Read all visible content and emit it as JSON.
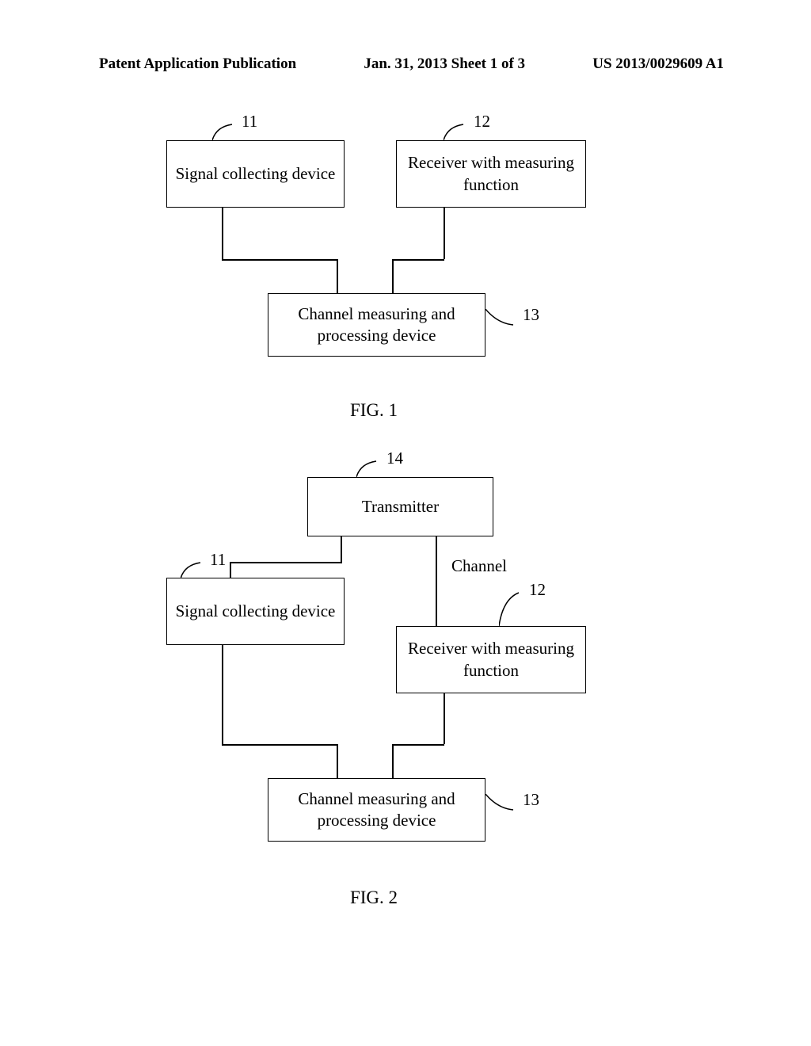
{
  "header": {
    "left": "Patent Application Publication",
    "center": "Jan. 31, 2013  Sheet 1 of 3",
    "right": "US 2013/0029609 A1"
  },
  "fig1": {
    "box11": "Signal collecting device",
    "box12": "Receiver with measuring function",
    "box13": "Channel measuring and processing device",
    "label11": "11",
    "label12": "12",
    "label13": "13",
    "caption": "FIG. 1"
  },
  "fig2": {
    "box11": "Signal collecting device",
    "box12": "Receiver with measuring function",
    "box13": "Channel measuring and processing device",
    "box14": "Transmitter",
    "label11": "11",
    "label12": "12",
    "label13": "13",
    "label14": "14",
    "labelChannel": "Channel",
    "caption": "FIG. 2"
  }
}
